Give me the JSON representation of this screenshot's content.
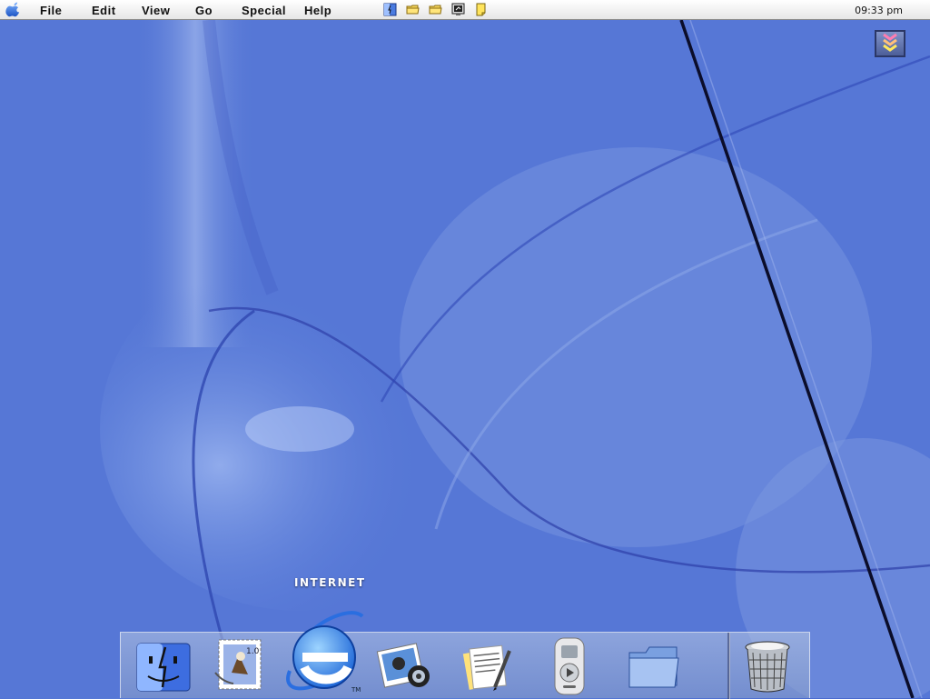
{
  "menubar": {
    "apple_icon": "apple-logo-icon",
    "items": [
      "File",
      "Edit",
      "View",
      "Go",
      "Special",
      "Help"
    ],
    "tray_icons": [
      "finder-face-icon",
      "folder-icon",
      "folder-icon",
      "monitor-icon",
      "note-icon"
    ],
    "clock": "09:33 pm"
  },
  "desktop": {
    "collapse_icon": "triple-chevron-down-icon"
  },
  "dock": {
    "hover_label": "INTERNET",
    "items": [
      {
        "name": "finder",
        "icon": "finder-icon"
      },
      {
        "name": "mail",
        "icon": "mail-stamp-icon",
        "stamp_text": "1.0"
      },
      {
        "name": "internet",
        "icon": "internet-explorer-icon",
        "tm": "TM"
      },
      {
        "name": "iphoto",
        "icon": "iphoto-icon"
      },
      {
        "name": "textedit",
        "icon": "document-pen-icon"
      },
      {
        "name": "media-player",
        "icon": "media-player-icon"
      },
      {
        "name": "documents-folder",
        "icon": "folder-icon"
      },
      {
        "name": "trash",
        "icon": "trash-icon"
      }
    ]
  },
  "colors": {
    "desktop": "#5b7fd9",
    "menubar": "#f0f0f0",
    "ie_blue": "#1a63d6"
  }
}
